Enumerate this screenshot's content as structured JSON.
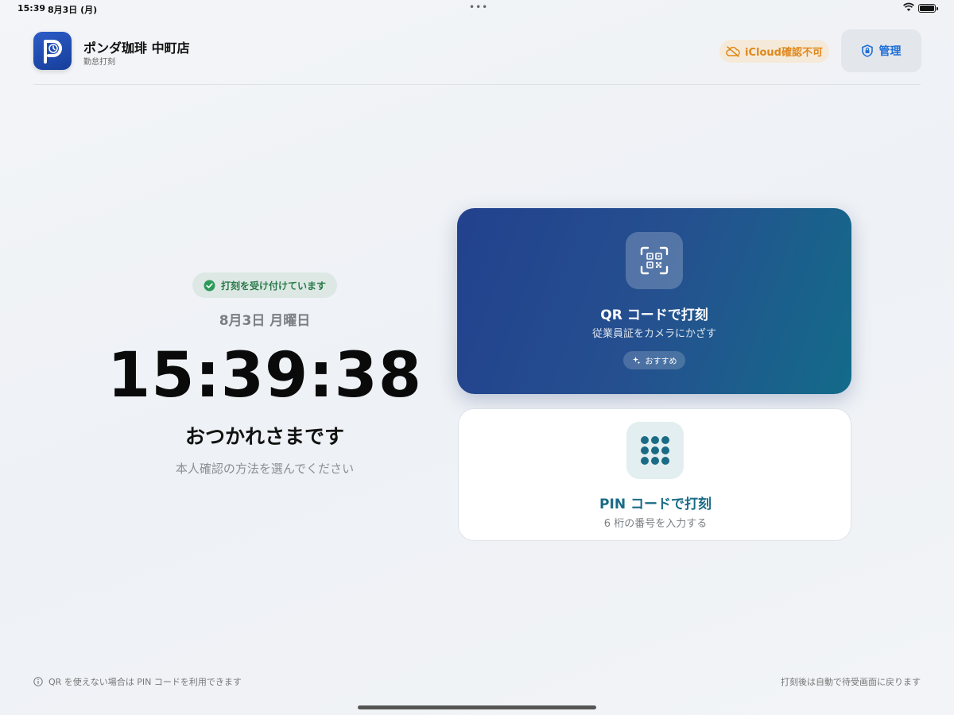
{
  "status_bar": {
    "time": "15:39",
    "date": "8月3日 (月)",
    "center_dots": "•••",
    "wifi_icon": "wifi-icon",
    "battery_icon": "battery-icon"
  },
  "header": {
    "app_icon": "clock-p-logo-icon",
    "store_name": "ポンダ珈琲 中町店",
    "store_subtitle": "勤怠打刻",
    "icloud_badge": "iCloud確認不可",
    "icloud_icon": "cloud-off-icon",
    "admin_label": "管理",
    "admin_icon": "shield-lock-icon"
  },
  "status": {
    "accept_label": "打刻を受け付けています",
    "accept_icon": "check-circle-icon"
  },
  "clock": {
    "date": "8月3日 月曜日",
    "time": "15:39:38",
    "greeting": "おつかれさまです",
    "instruction": "本人確認の方法を選んでください"
  },
  "qr_option": {
    "icon": "qr-scan-icon",
    "title": "QR コードで打刻",
    "subtitle": "従業員証をカメラにかざす",
    "recommend_label": "おすすめ",
    "recommend_icon": "sparkle-icon"
  },
  "pin_option": {
    "icon": "keypad-icon",
    "title": "PIN コードで打刻",
    "subtitle": "6 桁の番号を入力する"
  },
  "footer": {
    "left_icon": "info-icon",
    "left_text": "QR を使えない場合は PIN コードを利用できます",
    "right_text": "打刻後は自動で待受画面に戻ります"
  },
  "colors": {
    "accent_blue": "#1f6fd8",
    "warning_orange": "#e0871b",
    "success_green": "#2a7a4a",
    "pin_teal": "#1a6b86"
  }
}
